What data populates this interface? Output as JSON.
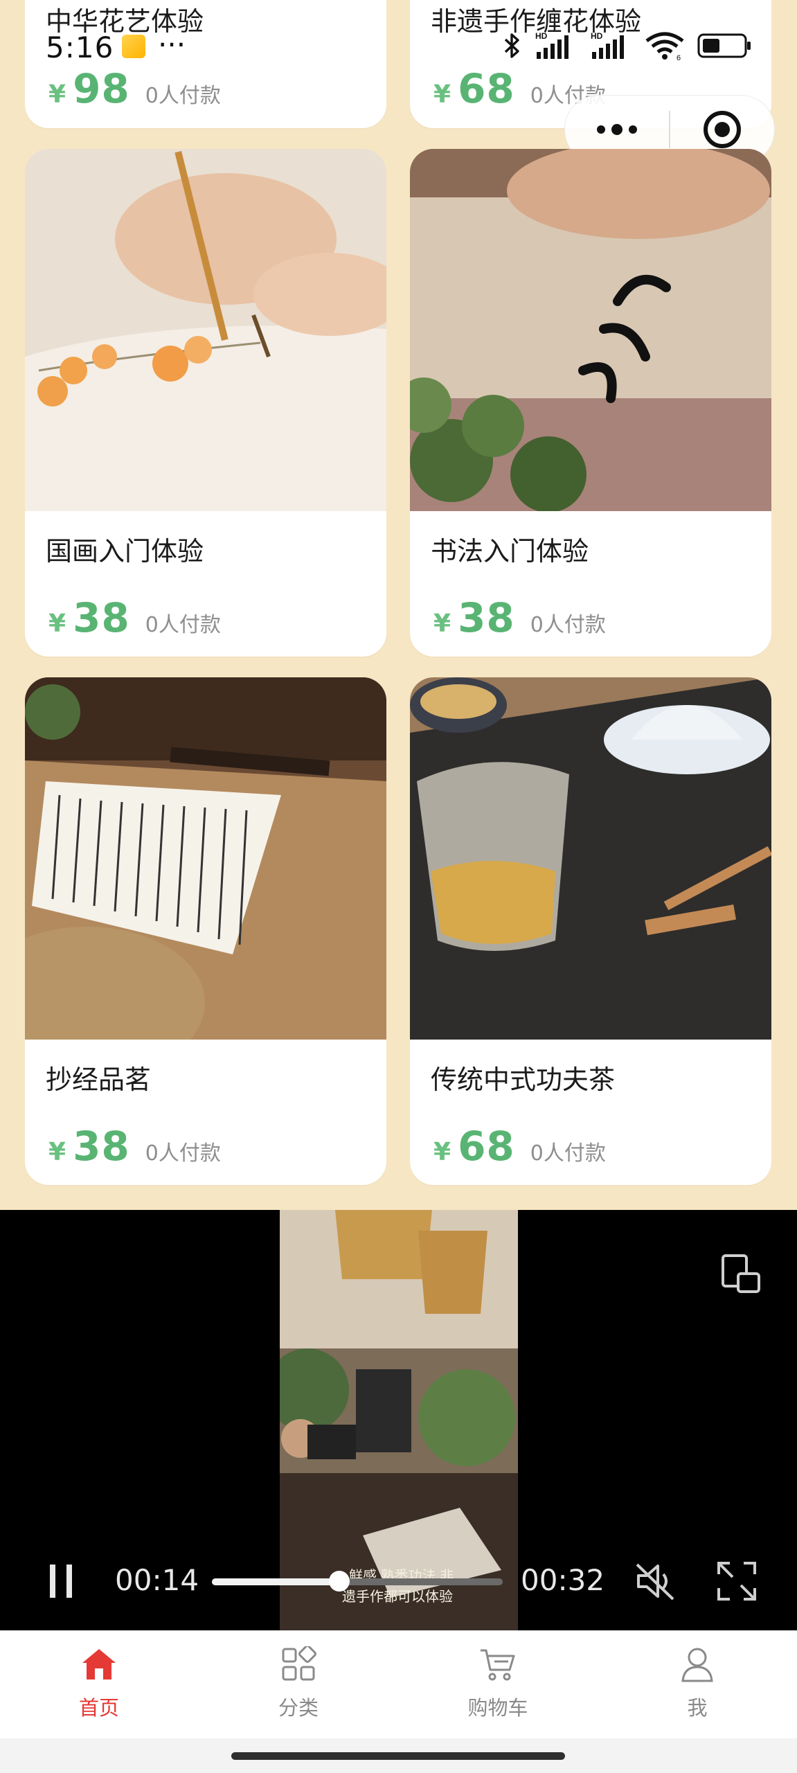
{
  "status_bar": {
    "time": "5:16",
    "more": "···",
    "signal_labels": [
      "HD",
      "HD"
    ],
    "wifi_badge": "6"
  },
  "cards": [
    {
      "title": "中华花艺体验",
      "price": "98",
      "currency": "¥",
      "paid": "0人付款"
    },
    {
      "title": "非遗手作缠花体验",
      "price": "68",
      "currency": "¥",
      "paid": "0人付款"
    },
    {
      "title": "国画入门体验",
      "price": "38",
      "currency": "¥",
      "paid": "0人付款"
    },
    {
      "title": "书法入门体验",
      "price": "38",
      "currency": "¥",
      "paid": "0人付款"
    },
    {
      "title": "抄经品茗",
      "price": "38",
      "currency": "¥",
      "paid": "0人付款"
    },
    {
      "title": "传统中式功夫茶",
      "price": "68",
      "currency": "¥",
      "paid": "0人付款"
    }
  ],
  "video": {
    "current_time": "00:14",
    "duration": "00:32",
    "progress_fraction": 0.4375,
    "subtitle_line1": "鲜感 熟悉功法 非",
    "subtitle_line2": "遗手作都可以体验"
  },
  "tabbar": {
    "active_color": "#e53935",
    "inactive_color": "#8a8a8a",
    "items": [
      {
        "label": "首页",
        "icon": "home-icon",
        "active": true
      },
      {
        "label": "分类",
        "icon": "grid-icon",
        "active": false
      },
      {
        "label": "购物车",
        "icon": "cart-icon",
        "active": false
      },
      {
        "label": "我",
        "icon": "user-icon",
        "active": false
      }
    ]
  },
  "colors": {
    "background": "#f6e6c3",
    "price_green": "#59b473"
  }
}
